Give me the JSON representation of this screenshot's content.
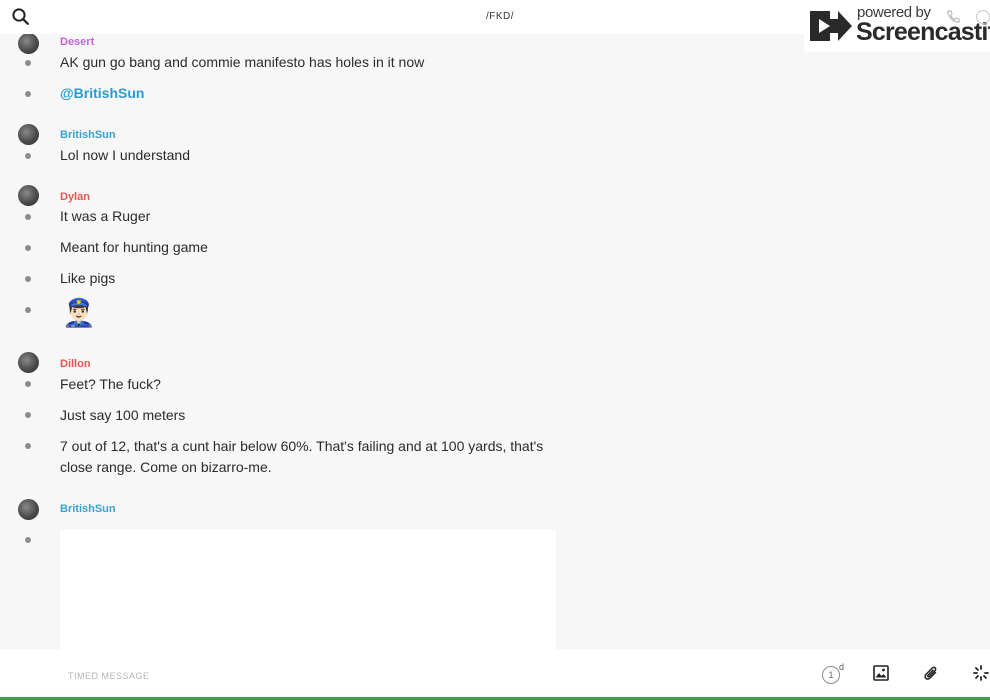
{
  "header": {
    "channel_title": "/FKD/",
    "search_icon": "search-icon"
  },
  "watermark": {
    "powered_by": "powered by",
    "brand": "Screencastify"
  },
  "messages": [
    {
      "author": "Desert",
      "author_color": "#c066d4",
      "lines": [
        {
          "text": "AK gun go bang and commie manifesto has holes in it now"
        },
        {
          "mention": "@BritishSun"
        }
      ]
    },
    {
      "author": "BritishSun",
      "author_color": "#3aa0cf",
      "lines": [
        {
          "text": "Lol now I understand"
        }
      ]
    },
    {
      "author": "Dylan",
      "author_color": "#e0574f",
      "lines": [
        {
          "text": "It was a Ruger"
        },
        {
          "text": "Meant for hunting game"
        },
        {
          "text": "Like pigs"
        },
        {
          "emoji": "👮🏻‍♂️",
          "emoji_name": "police-officer-emoji"
        }
      ]
    },
    {
      "author": "Dillon",
      "author_color": "#e0574f",
      "lines": [
        {
          "text": "Feet? The fuck?"
        },
        {
          "text": "Just say 100 meters"
        },
        {
          "text_line1": "7 out of 12, that's a cunt hair below 60%. That's failing and at 100 yards, that's",
          "text_line2": "close range. Come on bizarro-me."
        }
      ]
    },
    {
      "author": "BritishSun",
      "author_color": "#3aa0cf",
      "lines": [
        {
          "embed": "image-preview"
        }
      ]
    }
  ],
  "composer": {
    "placeholder": "TIMED MESSAGE",
    "timer_value": "1",
    "timer_unit": "d",
    "icons": [
      "timer-icon",
      "image-icon",
      "attachment-icon",
      "loading-icon"
    ]
  }
}
